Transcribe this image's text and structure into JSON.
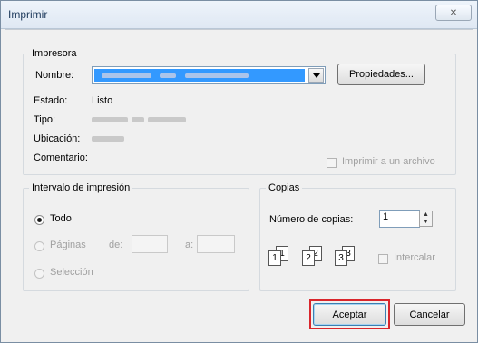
{
  "window": {
    "title": "Imprimir",
    "close_glyph": "✕"
  },
  "printer": {
    "group_label": "Impresora",
    "name_label": "Nombre:",
    "properties_button": "Propiedades...",
    "status_label": "Estado:",
    "status_value": "Listo",
    "type_label": "Tipo:",
    "location_label": "Ubicación:",
    "comment_label": "Comentario:",
    "print_to_file_label": "Imprimir a un archivo"
  },
  "range": {
    "group_label": "Intervalo de impresión",
    "all_label": "Todo",
    "pages_label": "Páginas",
    "from_label": "de:",
    "to_label": "a:",
    "selection_label": "Selección",
    "selected": "all"
  },
  "copies": {
    "group_label": "Copias",
    "count_label": "Número de copias:",
    "count_value": "1",
    "collate_label": "Intercalar",
    "collate_icon_pages": [
      "1",
      "2",
      "3"
    ]
  },
  "buttons": {
    "ok": "Aceptar",
    "cancel": "Cancelar"
  },
  "colors": {
    "selection_highlight": "#3399ff",
    "ok_highlight_border": "#d9262c"
  }
}
